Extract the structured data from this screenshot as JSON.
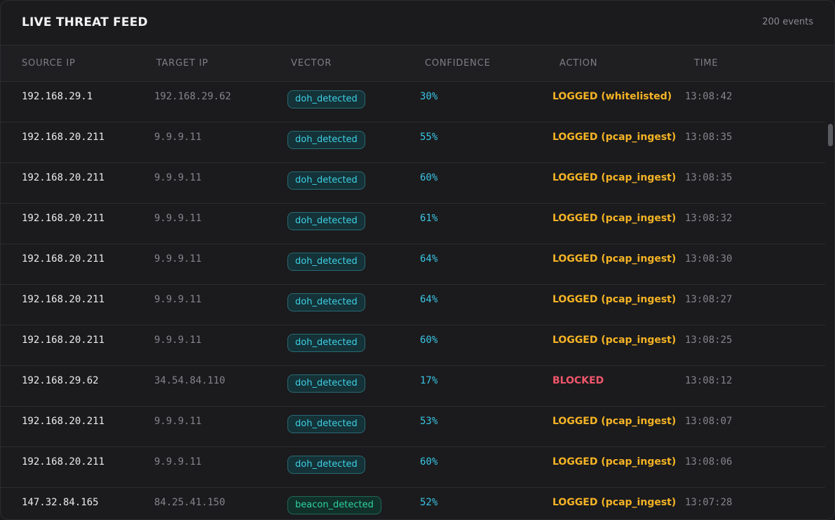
{
  "header": {
    "title": "LIVE THREAT FEED",
    "count": "200 events"
  },
  "columns": [
    "SOURCE IP",
    "TARGET IP",
    "VECTOR",
    "CONFIDENCE",
    "ACTION",
    "TIME"
  ],
  "colors": {
    "logged": "#f5b325",
    "blocked": "#f0566b"
  },
  "rows": [
    {
      "src": "192.168.29.1",
      "tgt": "192.168.29.62",
      "vector": "doh_detected",
      "conf": "30%",
      "action": "LOGGED (whitelisted)",
      "status": "logged",
      "time": "13:08:42"
    },
    {
      "src": "192.168.20.211",
      "tgt": "9.9.9.11",
      "vector": "doh_detected",
      "conf": "55%",
      "action": "LOGGED (pcap_ingest)",
      "status": "logged",
      "time": "13:08:35"
    },
    {
      "src": "192.168.20.211",
      "tgt": "9.9.9.11",
      "vector": "doh_detected",
      "conf": "60%",
      "action": "LOGGED (pcap_ingest)",
      "status": "logged",
      "time": "13:08:35"
    },
    {
      "src": "192.168.20.211",
      "tgt": "9.9.9.11",
      "vector": "doh_detected",
      "conf": "61%",
      "action": "LOGGED (pcap_ingest)",
      "status": "logged",
      "time": "13:08:32"
    },
    {
      "src": "192.168.20.211",
      "tgt": "9.9.9.11",
      "vector": "doh_detected",
      "conf": "64%",
      "action": "LOGGED (pcap_ingest)",
      "status": "logged",
      "time": "13:08:30"
    },
    {
      "src": "192.168.20.211",
      "tgt": "9.9.9.11",
      "vector": "doh_detected",
      "conf": "64%",
      "action": "LOGGED (pcap_ingest)",
      "status": "logged",
      "time": "13:08:27"
    },
    {
      "src": "192.168.20.211",
      "tgt": "9.9.9.11",
      "vector": "doh_detected",
      "conf": "60%",
      "action": "LOGGED (pcap_ingest)",
      "status": "logged",
      "time": "13:08:25"
    },
    {
      "src": "192.168.29.62",
      "tgt": "34.54.84.110",
      "vector": "doh_detected",
      "conf": "17%",
      "action": "BLOCKED",
      "status": "blocked",
      "time": "13:08:12"
    },
    {
      "src": "192.168.20.211",
      "tgt": "9.9.9.11",
      "vector": "doh_detected",
      "conf": "53%",
      "action": "LOGGED (pcap_ingest)",
      "status": "logged",
      "time": "13:08:07"
    },
    {
      "src": "192.168.20.211",
      "tgt": "9.9.9.11",
      "vector": "doh_detected",
      "conf": "60%",
      "action": "LOGGED (pcap_ingest)",
      "status": "logged",
      "time": "13:08:06"
    },
    {
      "src": "147.32.84.165",
      "tgt": "84.25.41.150",
      "vector": "beacon_detected",
      "conf": "52%",
      "action": "LOGGED (pcap_ingest)",
      "status": "logged",
      "time": "13:07:28"
    }
  ]
}
